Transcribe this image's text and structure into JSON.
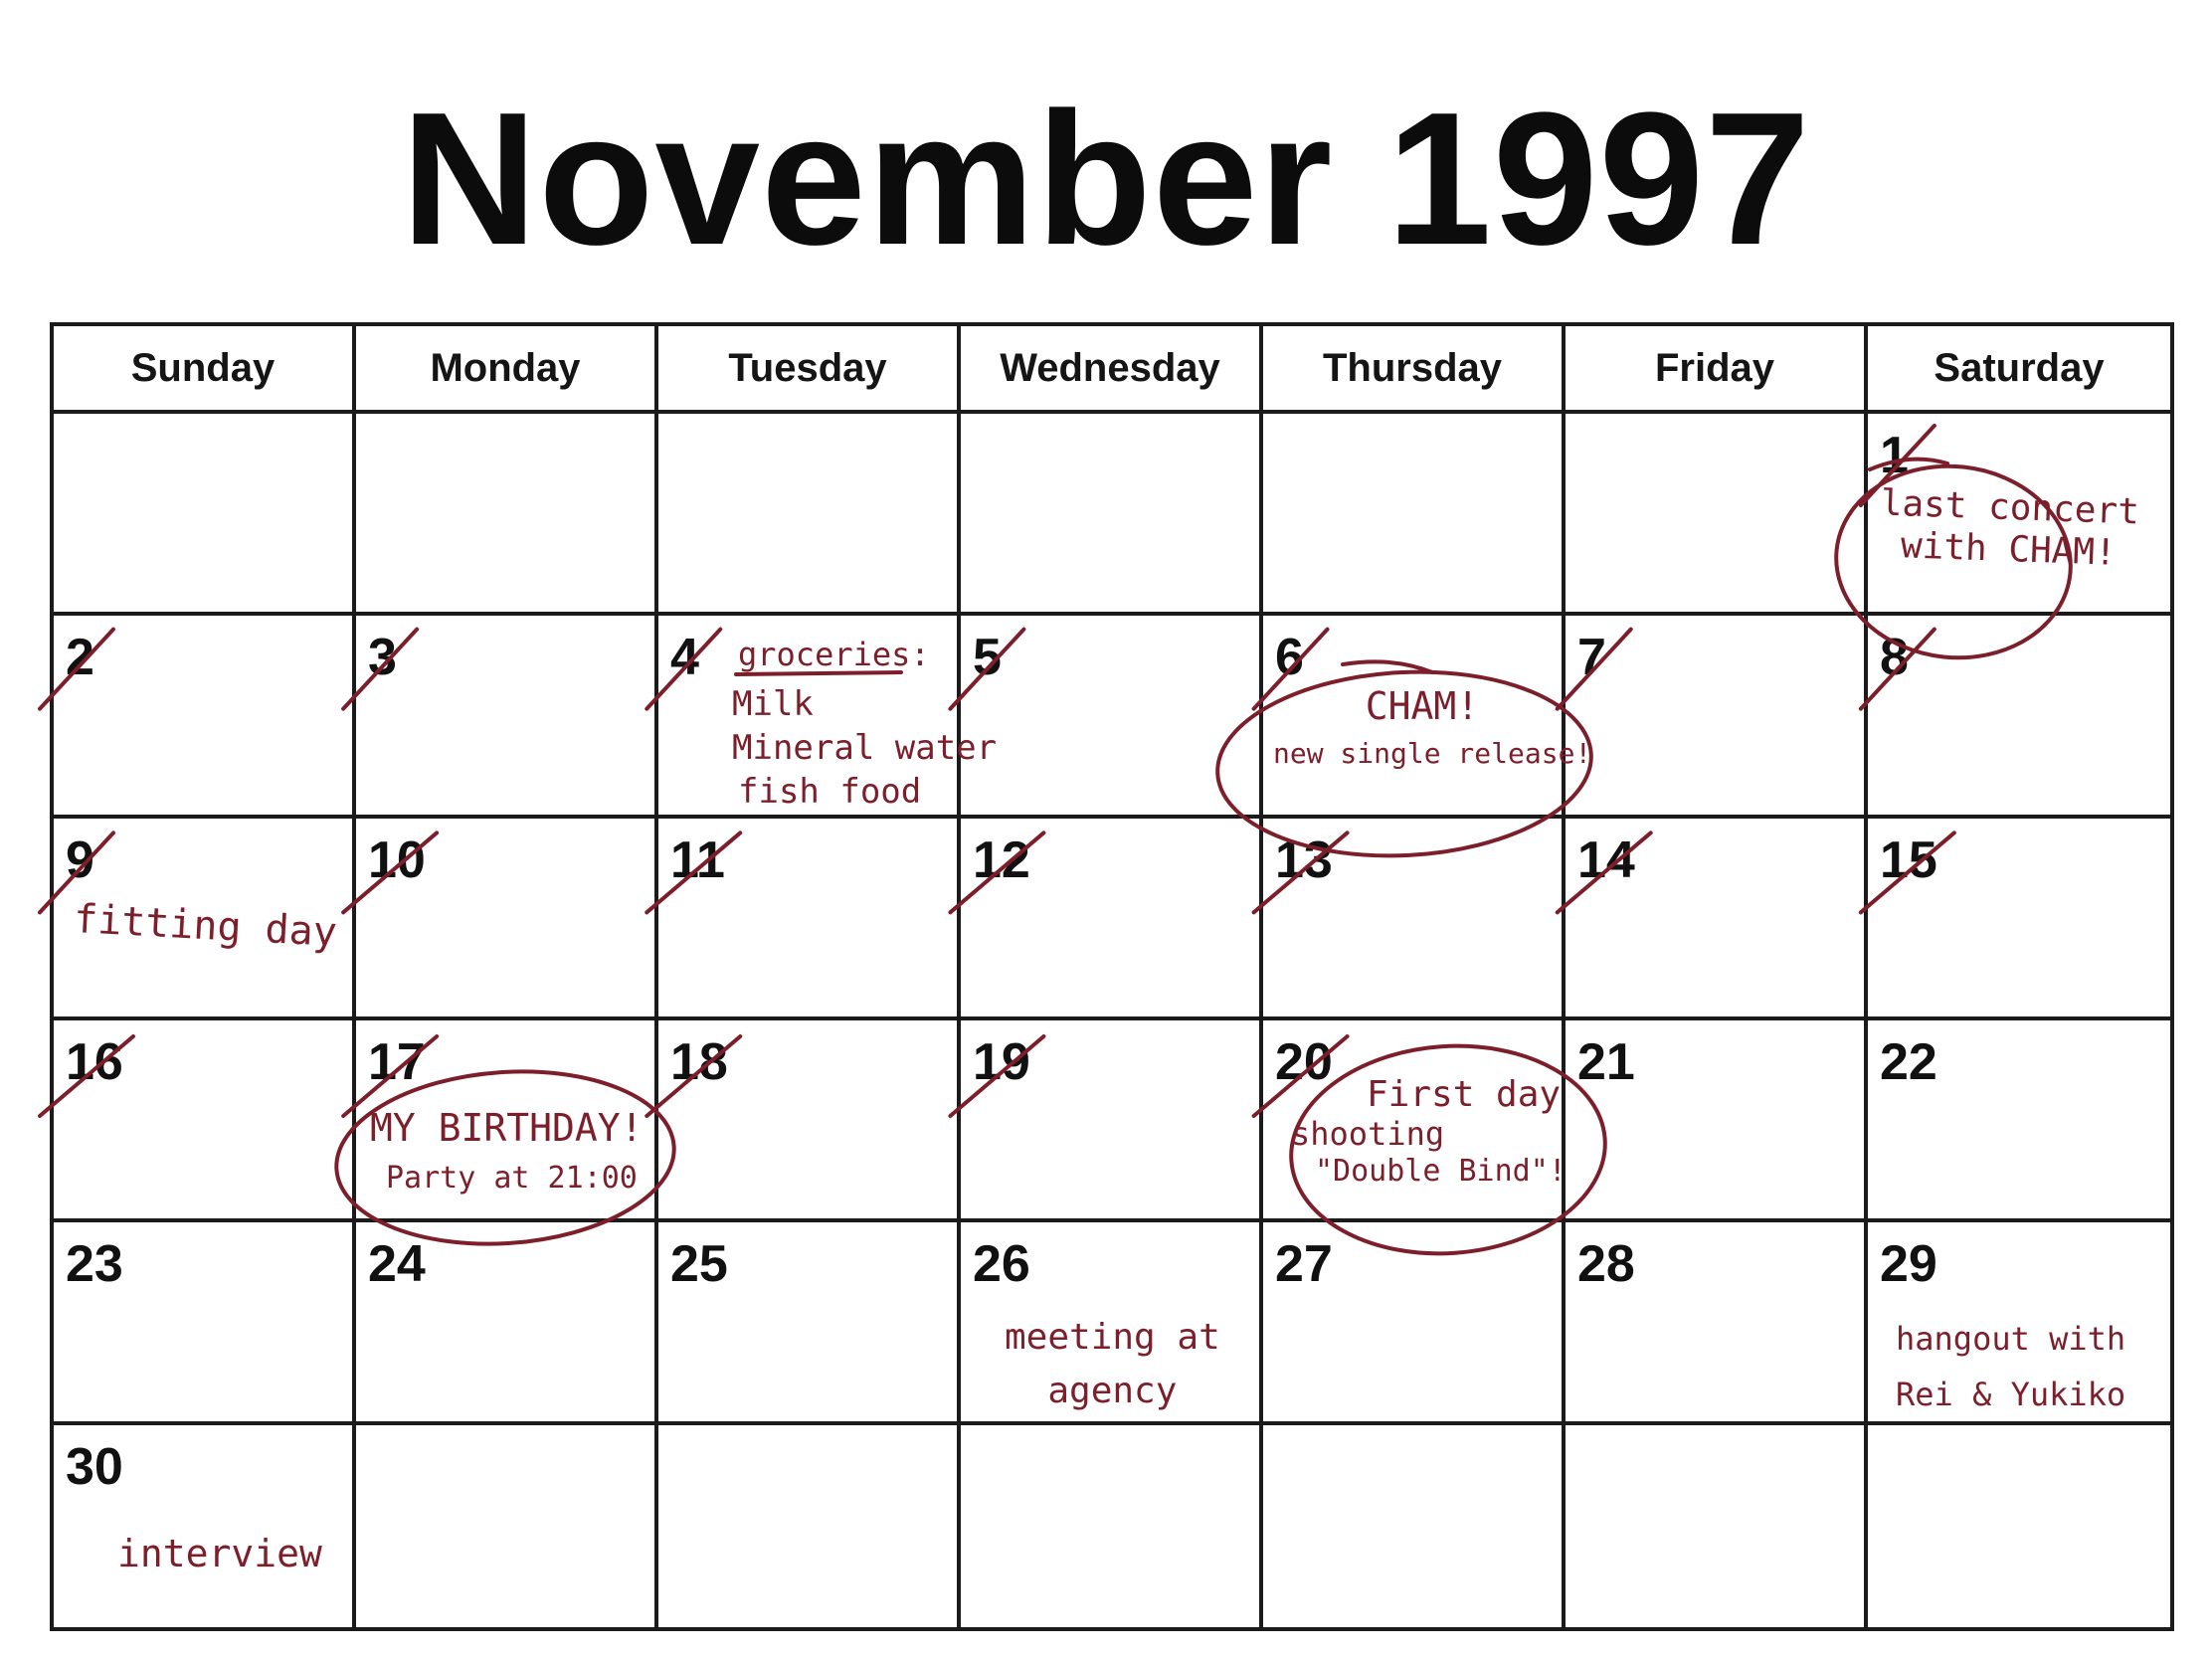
{
  "title": "November 1997",
  "weekdays": [
    "Sunday",
    "Monday",
    "Tuesday",
    "Wednesday",
    "Thursday",
    "Friday",
    "Saturday"
  ],
  "crossed_out_days": [
    1,
    2,
    3,
    4,
    5,
    6,
    7,
    8,
    9,
    10,
    11,
    12,
    13,
    14,
    15,
    16,
    17,
    18,
    19,
    20
  ],
  "calendar": [
    [
      "",
      "",
      "",
      "",
      "",
      "",
      "1"
    ],
    [
      "2",
      "3",
      "4",
      "5",
      "6",
      "7",
      "8"
    ],
    [
      "9",
      "10",
      "11",
      "12",
      "13",
      "14",
      "15"
    ],
    [
      "16",
      "17",
      "18",
      "19",
      "20",
      "21",
      "22"
    ],
    [
      "23",
      "24",
      "25",
      "26",
      "27",
      "28",
      "29"
    ],
    [
      "30",
      "",
      "",
      "",
      "",
      "",
      ""
    ]
  ],
  "notes": {
    "nov1": [
      "last concert",
      "with CHAM!"
    ],
    "nov4_heading": "groceries:",
    "nov4_items": [
      "Milk",
      "Mineral water",
      "fish food"
    ],
    "nov6": [
      "CHAM!",
      "new single release!"
    ],
    "nov9": "fitting day",
    "nov17": [
      "MY BIRTHDAY!",
      "Party at 21:00"
    ],
    "nov20": [
      "First day",
      "shooting",
      "\"Double Bind\"!"
    ],
    "nov26": [
      "meeting at",
      "agency"
    ],
    "nov29": [
      "hangout with",
      "Rei & Yukiko"
    ],
    "nov30": "interview"
  },
  "colors": {
    "ink": "#7c1f2b",
    "grid": "#1b1b1b",
    "text": "#111111"
  }
}
